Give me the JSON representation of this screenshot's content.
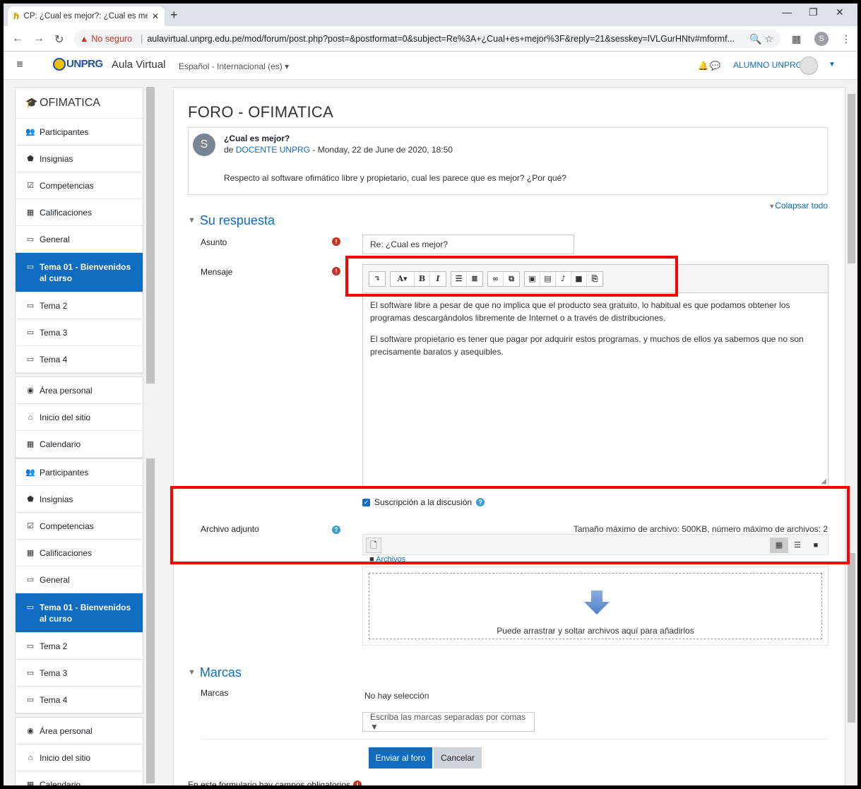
{
  "browser": {
    "tab_title": "CP: ¿Cual es mejor?: ¿Cual es mejor",
    "tab_close": "✕",
    "new_tab": "+",
    "insecure_label": "No seguro",
    "url": "aulavirtual.unprg.edu.pe/mod/forum/post.php?post=&postformat=0&subject=Re%3A+¿Cual+es+mejor%3F&reply=21&sesskey=lVLGurHNtv#mformf...",
    "profile_letter": "S"
  },
  "navbar": {
    "logo_text": "UNPRG",
    "site_name": "Aula Virtual",
    "language": "Español - Internacional (es) ▾",
    "user_name": "ALUMNO UNPRG"
  },
  "sidebar": {
    "course": "OFIMATICA",
    "items_a": [
      {
        "icon": "👥",
        "label": "Participantes"
      },
      {
        "icon": "⬟",
        "label": "Insignias"
      },
      {
        "icon": "☑",
        "label": "Competencias"
      },
      {
        "icon": "▦",
        "label": "Calificaciones"
      },
      {
        "icon": "▭",
        "label": "General"
      }
    ],
    "active_item": "Tema 01 - Bienvenidos al curso",
    "items_b": [
      {
        "icon": "▭",
        "label": "Tema 2"
      },
      {
        "icon": "▭",
        "label": "Tema 3"
      },
      {
        "icon": "▭",
        "label": "Tema 4"
      }
    ],
    "items_c": [
      {
        "icon": "◉",
        "label": "Área personal"
      },
      {
        "icon": "⌂",
        "label": "Inicio del sitio"
      },
      {
        "icon": "▦",
        "label": "Calendario"
      }
    ]
  },
  "main": {
    "heading": "FORO - OFIMATICA",
    "post": {
      "avatar": "S",
      "subject": "¿Cual es mejor?",
      "by_prefix": "de",
      "author": "DOCENTE UNPRG",
      "date": "- Monday, 22 de June de 2020, 18:50",
      "message": "Respecto al software ofimático libre y propietario, cual les parece que es mejor? ¿Por qué?"
    },
    "collapse_all": "Colapsar todo",
    "section_reply": "Su respuesta",
    "subject_label": "Asunto",
    "subject_value": "Re: ¿Cual es mejor?",
    "message_label": "Mensaje",
    "editor_p1": "El software libre a pesar de que no implica que el producto sea gratuito, lo habitual es que podamos obtener los programas descargándolos libremente de Internet o a través de distribuciones.",
    "editor_p2": "El software propietario es tener que pagar por adquirir estos programas, y muchos de ellos ya sabemos que no son precisamente baratos y asequibles.",
    "subscription_label": "Suscripción a la discusión",
    "attachment_label": "Archivo adjunto",
    "file_limits": "Tamaño máximo de archivo: 500KB, número máximo de archivos: 2",
    "files_folder": "Archivos",
    "dropzone_text": "Puede arrastrar y soltar archivos aquí para añadirlos",
    "section_tags": "Marcas",
    "tags_label": "Marcas",
    "no_selection": "No hay selección",
    "tags_placeholder": "Escriba las marcas separadas por comas ▼",
    "submit": "Enviar al foro",
    "cancel": "Cancelar",
    "required_note": "En este formulario hay campos obligatorios",
    "required_dot": "."
  },
  "colors": {
    "primary": "#0f6cbf",
    "highlight": "#ff0000",
    "required": "#ca3120"
  }
}
